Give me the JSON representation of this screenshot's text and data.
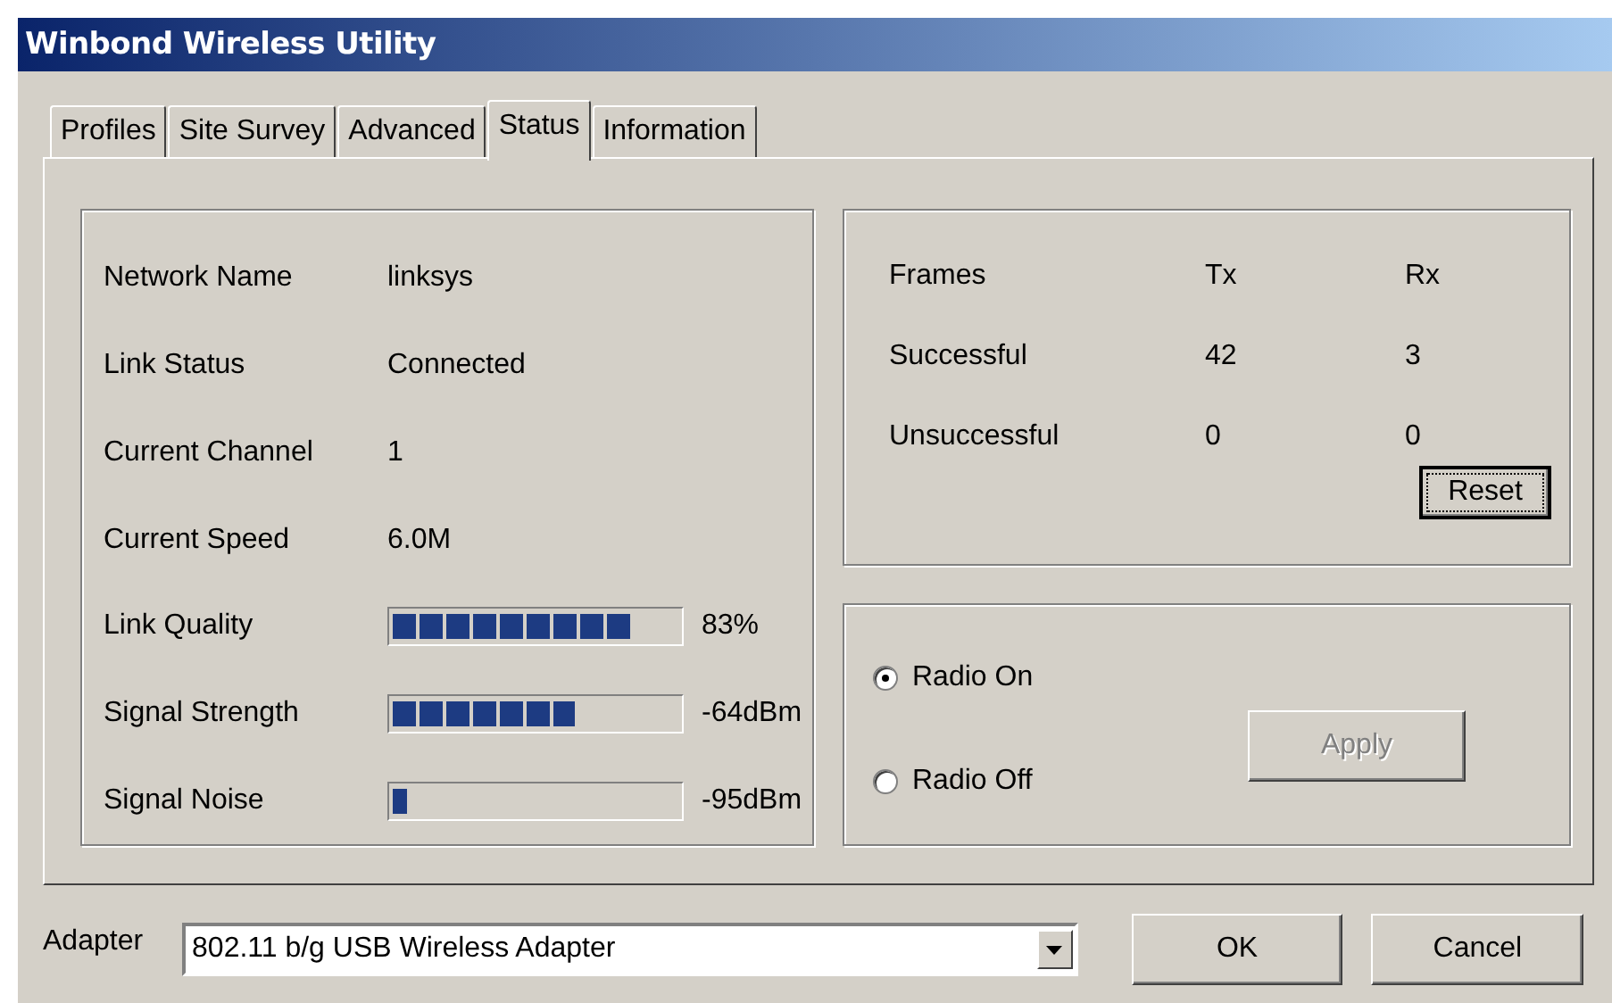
{
  "window": {
    "title": "Winbond Wireless Utility"
  },
  "tabs": [
    {
      "label": "Profiles",
      "selected": false
    },
    {
      "label": "Site Survey",
      "selected": false
    },
    {
      "label": "Advanced",
      "selected": false
    },
    {
      "label": "Status",
      "selected": true
    },
    {
      "label": "Information",
      "selected": false
    }
  ],
  "status": [
    {
      "kind": "text",
      "label": "Network Name",
      "value": "linksys"
    },
    {
      "kind": "text",
      "label": "Link Status",
      "value": "Connected"
    },
    {
      "kind": "text",
      "label": "Current Channel",
      "value": "1"
    },
    {
      "kind": "text",
      "label": "Current Speed",
      "value": "6.0M"
    },
    {
      "kind": "meter",
      "label": "Link Quality",
      "level": 0.83,
      "reading": "83%"
    },
    {
      "kind": "meter",
      "label": "Signal Strength",
      "level": 0.64,
      "reading": "-64dBm"
    },
    {
      "kind": "meter",
      "label": "Signal Noise",
      "level": 0.05,
      "reading": "-95dBm"
    }
  ],
  "frames": {
    "columns": [
      "Frames",
      "Tx",
      "Rx"
    ],
    "rows": [
      [
        "Successful",
        "42",
        "3"
      ],
      [
        "Unsuccessful",
        "0",
        "0"
      ]
    ],
    "reset_button": {
      "label": "Reset",
      "focused": true
    }
  },
  "radio": {
    "options": [
      {
        "label": "Radio On",
        "selected": true
      },
      {
        "label": "Radio Off",
        "selected": false
      }
    ],
    "apply_button": {
      "label": "Apply",
      "disabled": true
    }
  },
  "adapter": {
    "label": "Adapter",
    "value": "802.11 b/g USB Wireless Adapter"
  },
  "buttons": [
    "OK",
    "Cancel"
  ]
}
